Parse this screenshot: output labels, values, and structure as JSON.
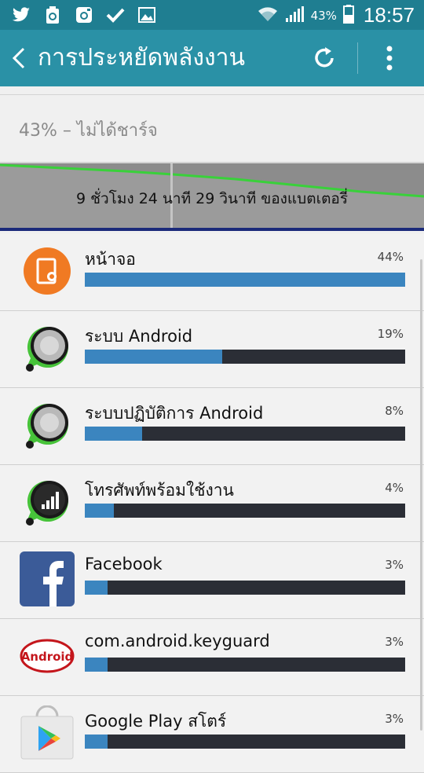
{
  "statusbar": {
    "battery_pct": "43%",
    "time": "18:57",
    "icons": [
      "twitter-icon",
      "recycle-icon",
      "instagram-icon",
      "check-icon",
      "image-icon",
      "wifi-icon",
      "signal-icon",
      "battery-icon"
    ]
  },
  "appbar": {
    "title": "การประหยัดพลังงาน"
  },
  "battery": {
    "status": "43% – ไม่ได้ชาร์จ",
    "remaining": "9 ชั่วโมง 24 นาที 29 วินาที ของแบตเตอรี่"
  },
  "colors": {
    "statusbar": "#1f7e91",
    "appbar": "#2a91a6",
    "bar_fill": "#3b85bf",
    "bar_track": "#2b2e36",
    "graph_line": "#39d13a"
  },
  "usage": [
    {
      "name": "หน้าจอ",
      "pct_label": "44%",
      "fraction": 1.0,
      "icon": "screen-brightness-icon"
    },
    {
      "name": "ระบบ Android",
      "pct_label": "19%",
      "fraction": 0.43,
      "icon": "android-system-icon"
    },
    {
      "name": "ระบบปฏิบัติการ Android",
      "pct_label": "8%",
      "fraction": 0.18,
      "icon": "android-os-icon"
    },
    {
      "name": "โทรศัพท์พร้อมใช้งาน",
      "pct_label": "4%",
      "fraction": 0.09,
      "icon": "cell-standby-icon"
    },
    {
      "name": "Facebook",
      "pct_label": "3%",
      "fraction": 0.07,
      "icon": "facebook-icon"
    },
    {
      "name": "com.android.keyguard",
      "pct_label": "3%",
      "fraction": 0.07,
      "icon": "android-keyguard-icon"
    },
    {
      "name": "Google Play สโตร์",
      "pct_label": "3%",
      "fraction": 0.07,
      "icon": "google-play-store-icon"
    }
  ]
}
